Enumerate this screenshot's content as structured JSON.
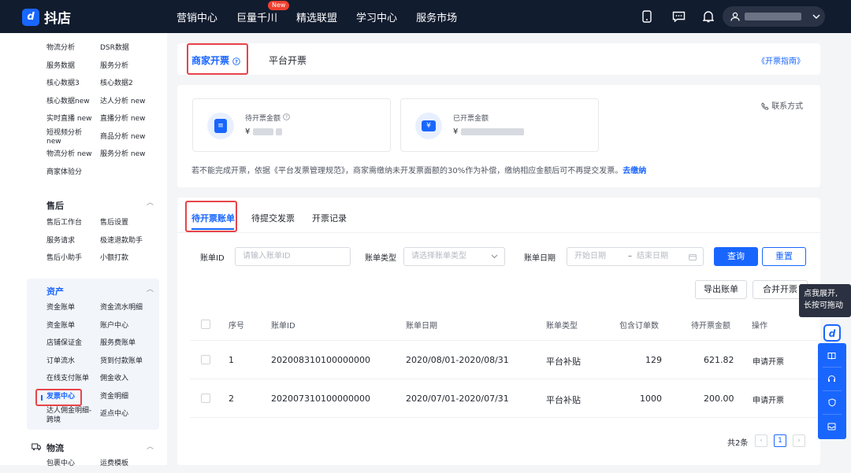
{
  "topbar": {
    "logo_text": "抖店",
    "nav": [
      "营销中心",
      "巨量千川",
      "精选联盟",
      "学习中心",
      "服务市场"
    ],
    "new_badge": "New",
    "user_name_hidden": true
  },
  "sidebar": {
    "data_items": [
      "物流分析",
      "DSR数据",
      "服务数据",
      "服务分析",
      "核心数据3",
      "核心数据2",
      "核心数据new",
      "达人分析 new",
      "实时直播 new",
      "直播分析 new",
      "短视频分析 new",
      "商品分析 new",
      "物流分析 new",
      "服务分析 new",
      "商家体验分"
    ],
    "aftersale_title": "售后",
    "aftersale_items": [
      "售后工作台",
      "售后设置",
      "服务请求",
      "极速退款助手",
      "售后小助手",
      "小额打款"
    ],
    "asset_title": "资产",
    "asset_items": [
      "资金账单",
      "资金流水明细",
      "资金账单",
      "账户中心",
      "店铺保证金",
      "服务费账单",
      "订单流水",
      "货到付款账单",
      "在线支付账单",
      "佣金收入",
      "发票中心",
      "资金明细",
      "达人佣金明细-跨境",
      "返点中心"
    ],
    "logistics_title": "物流",
    "logistics_items": [
      "包裹中心",
      "运费模板"
    ]
  },
  "header_tabs": {
    "merchant": "商家开票",
    "platform": "平台开票",
    "guide": "《开票指南》"
  },
  "summary": {
    "contact": "联系方式",
    "pending_label": "待开票金额",
    "issued_label": "已开票金额",
    "currency": "¥",
    "notice": "若不能完成开票，依据《平台发票管理规范》，商家需缴纳未开发票面额的30%作为补偿，缴纳相应金额后可不再提交发票。",
    "notice_link": "去缴纳"
  },
  "bill_tabs": [
    "待开票账单",
    "待提交发票",
    "开票记录"
  ],
  "filters": {
    "bill_id_label": "账单ID",
    "bill_id_placeholder": "请输入账单ID",
    "bill_type_label": "账单类型",
    "bill_type_placeholder": "请选择账单类型",
    "bill_date_label": "账单日期",
    "start_placeholder": "开始日期",
    "end_placeholder": "结束日期",
    "date_sep": "–",
    "query": "查询",
    "reset": "重置",
    "export": "导出账单",
    "merge": "合并开票"
  },
  "table": {
    "headers": [
      "序号",
      "账单ID",
      "账单日期",
      "账单类型",
      "包含订单数",
      "待开票金额",
      "操作"
    ],
    "rows": [
      {
        "no": "1",
        "id": "202008310100000000",
        "date": "2020/08/01-2020/08/31",
        "type": "平台补贴",
        "orders": "129",
        "amount": "621.82",
        "action": "申请开票"
      },
      {
        "no": "2",
        "id": "202007310100000000",
        "date": "2020/07/01-2020/07/31",
        "type": "平台补贴",
        "orders": "1000",
        "amount": "200.00",
        "action": "申请开票"
      }
    ],
    "total": "共2条",
    "current_page": "1"
  },
  "floating": {
    "tip_line1": "点我展开,",
    "tip_line2": "长按可拖动"
  },
  "colors": {
    "brand_blue": "#1966ff",
    "nav_bg": "#121c2f",
    "highlight_red": "#e8434a"
  }
}
